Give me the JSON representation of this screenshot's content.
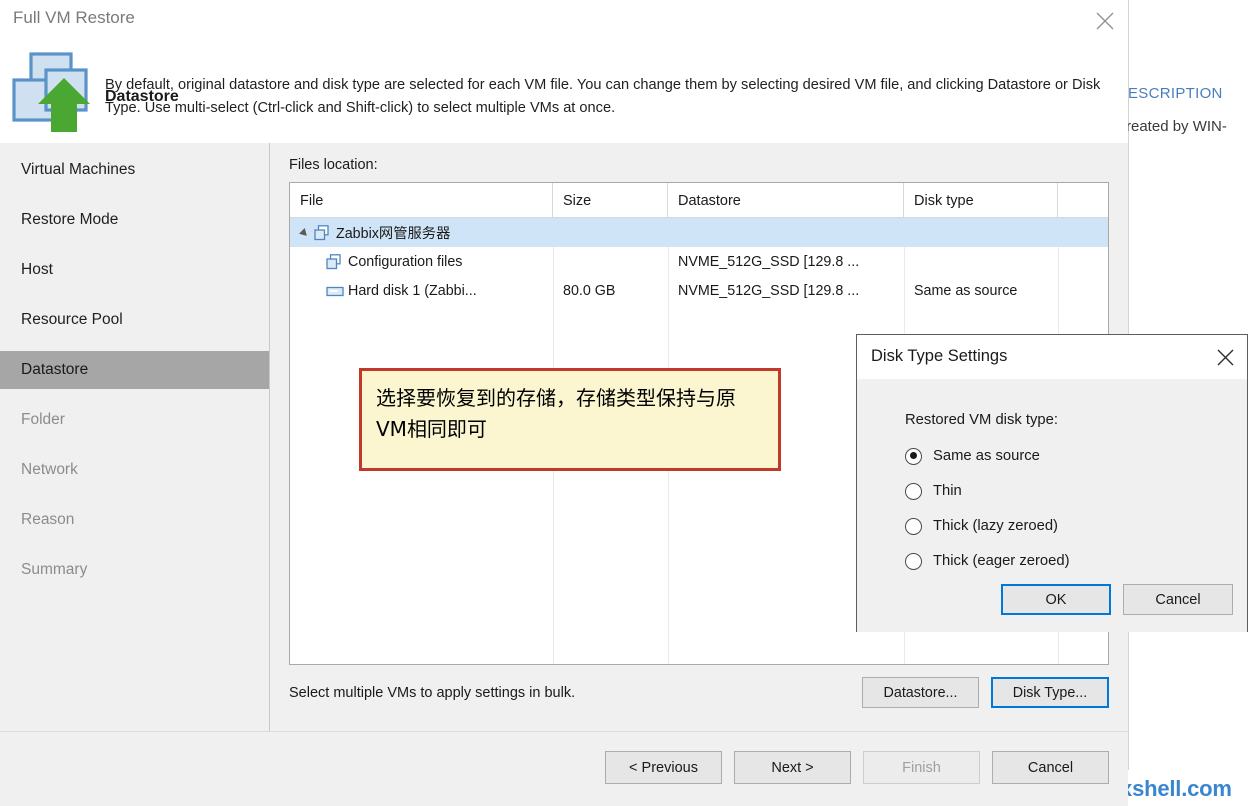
{
  "window": {
    "title": "Full VM Restore",
    "close_icon": "close-icon"
  },
  "header": {
    "icon": "datastore-restore-icon",
    "title": "Datastore",
    "description": "By default, original datastore and disk type are selected for each VM file. You can change them by selecting desired VM file, and clicking Datastore or Disk Type. Use multi-select (Ctrl-click and Shift-click) to select multiple VMs at once."
  },
  "sidebar": {
    "items": [
      {
        "label": "Virtual Machines",
        "state": "visited"
      },
      {
        "label": "Restore Mode",
        "state": "visited"
      },
      {
        "label": "Host",
        "state": "visited"
      },
      {
        "label": "Resource Pool",
        "state": "visited"
      },
      {
        "label": "Datastore",
        "state": "active"
      },
      {
        "label": "Folder",
        "state": "upcoming"
      },
      {
        "label": "Network",
        "state": "upcoming"
      },
      {
        "label": "Reason",
        "state": "upcoming"
      },
      {
        "label": "Summary",
        "state": "upcoming"
      }
    ]
  },
  "main": {
    "files_label": "Files location:",
    "table": {
      "columns": [
        "File",
        "Size",
        "Datastore",
        "Disk type"
      ],
      "rows": [
        {
          "file": "Zabbix网管服务器",
          "size": "",
          "datastore": "",
          "disk_type": "",
          "icon": "vm-icon",
          "indent": 0,
          "expanded": true,
          "selected": true
        },
        {
          "file": "Configuration files",
          "size": "",
          "datastore": "NVME_512G_SSD [129.8 ...",
          "disk_type": "",
          "icon": "vm-icon",
          "indent": 1,
          "expanded": false,
          "selected": false
        },
        {
          "file": "Hard disk 1 (Zabbi...",
          "size": "80.0 GB",
          "datastore": "NVME_512G_SSD [129.8 ...",
          "disk_type": "Same as source",
          "icon": "hard-disk-icon",
          "indent": 1,
          "expanded": false,
          "selected": false
        }
      ]
    },
    "bulk_note": "Select multiple VMs to apply settings in bulk.",
    "datastore_button": "Datastore...",
    "disk_type_button": "Disk Type..."
  },
  "annotation": {
    "text": "选择要恢复到的存储，存储类型保持与原VM相同即可",
    "border_color": "#c0392b",
    "fill_color": "#fbf6cf"
  },
  "dialog": {
    "title": "Disk Type Settings",
    "close_icon": "close-icon",
    "label": "Restored VM disk type:",
    "options": [
      {
        "label": "Same as source",
        "checked": true
      },
      {
        "label": "Thin",
        "checked": false
      },
      {
        "label": "Thick (lazy zeroed)",
        "checked": false
      },
      {
        "label": "Thick (eager zeroed)",
        "checked": false
      }
    ],
    "ok_button": "OK",
    "cancel_button": "Cancel"
  },
  "footer": {
    "previous": "< Previous",
    "next": "Next >",
    "finish": "Finish",
    "cancel": "Cancel",
    "finish_disabled": true
  },
  "background": {
    "description_label": "ESCRIPTION",
    "description_text": "reated by WIN-",
    "watermark": "xxshell.com",
    "accent_color": "#4a7ebb"
  }
}
